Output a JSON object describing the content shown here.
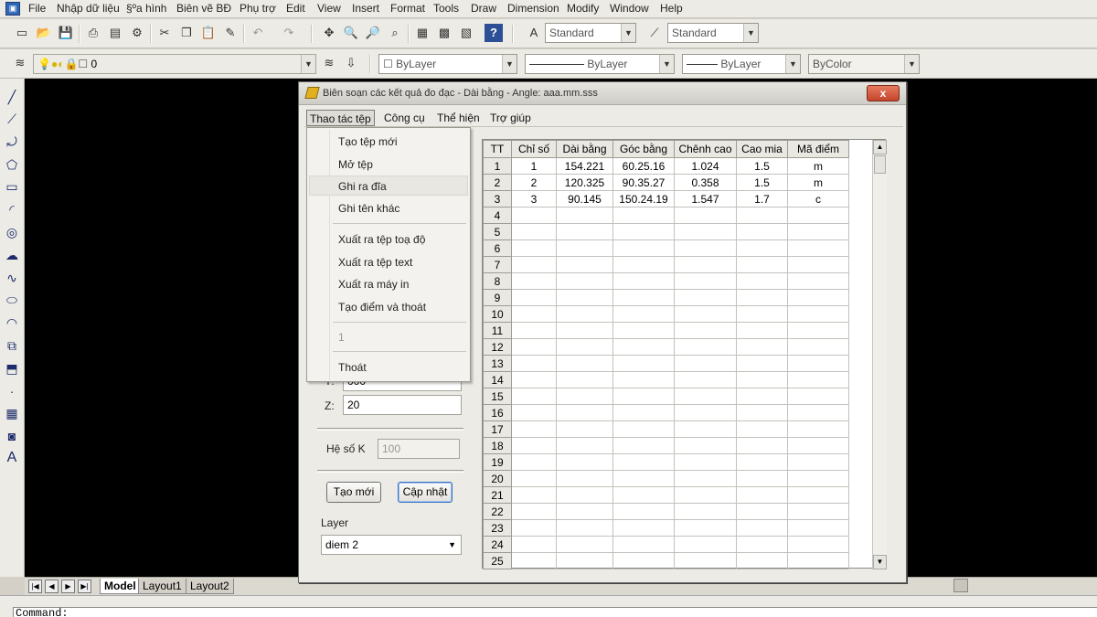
{
  "app": {
    "menu": [
      "File",
      "Nhập dữ liệu",
      "§ºa hình",
      "Biên vẽ BĐ",
      "Phụ trợ",
      "Edit",
      "View",
      "Insert",
      "Format",
      "Tools",
      "Draw",
      "Dimension",
      "Modify",
      "Window",
      "Help"
    ]
  },
  "toolbar": {
    "text_style": "Standard",
    "dim_style": "Standard",
    "layer_value": "0",
    "color": "ByLayer",
    "linetype": "ByLayer",
    "lineweight": "ByLayer",
    "plotstyle": "ByColor"
  },
  "layout_tabs": [
    "Model",
    "Layout1",
    "Layout2"
  ],
  "command": {
    "prompt": "Command:"
  },
  "dialog": {
    "title": "Biên soạn các kết quả đo đạc - Dài bằng - Angle: aaa.mm.sss",
    "close": "x",
    "menu": [
      "Thao tác tệp",
      "Công cụ",
      "Thể hiện",
      "Trợ giúp"
    ],
    "file_menu": {
      "items": [
        "Tạo tệp mới",
        "Mở tệp",
        "Ghi ra đĩa",
        "Ghi tên khác",
        "Xuất ra tệp toạ độ",
        "Xuất ra tệp text",
        "Xuất ra máy in",
        "Tạo điểm và thoát",
        "1",
        "Thoát"
      ],
      "highlighted": "Ghi ra đĩa"
    },
    "form": {
      "y_label": "Y:",
      "y_value": "000",
      "z_label": "Z:",
      "z_value": "20",
      "k_label": "Hệ số K",
      "k_value": "100",
      "btn_new": "Tạo mới",
      "btn_update": "Cập nhật",
      "layer_label": "Layer",
      "layer_value": "diem 2"
    },
    "grid": {
      "headers": [
        "TT",
        "Chỉ số",
        "Dài bằng",
        "Góc bằng",
        "Chênh cao",
        "Cao mia",
        "Mã điểm"
      ],
      "rows": [
        [
          "1",
          "1",
          "154.221",
          "60.25.16",
          "1.024",
          "1.5",
          "m"
        ],
        [
          "2",
          "2",
          "120.325",
          "90.35.27",
          "0.358",
          "1.5",
          "m"
        ],
        [
          "3",
          "3",
          "90.145",
          "150.24.19",
          "1.547",
          "1.7",
          "c"
        ],
        [
          "4",
          "",
          "",
          "",
          "",
          "",
          ""
        ],
        [
          "5",
          "",
          "",
          "",
          "",
          "",
          ""
        ],
        [
          "6",
          "",
          "",
          "",
          "",
          "",
          ""
        ],
        [
          "7",
          "",
          "",
          "",
          "",
          "",
          ""
        ],
        [
          "8",
          "",
          "",
          "",
          "",
          "",
          ""
        ],
        [
          "9",
          "",
          "",
          "",
          "",
          "",
          ""
        ],
        [
          "10",
          "",
          "",
          "",
          "",
          "",
          ""
        ],
        [
          "11",
          "",
          "",
          "",
          "",
          "",
          ""
        ],
        [
          "12",
          "",
          "",
          "",
          "",
          "",
          ""
        ],
        [
          "13",
          "",
          "",
          "",
          "",
          "",
          ""
        ],
        [
          "14",
          "",
          "",
          "",
          "",
          "",
          ""
        ],
        [
          "15",
          "",
          "",
          "",
          "",
          "",
          ""
        ],
        [
          "16",
          "",
          "",
          "",
          "",
          "",
          ""
        ],
        [
          "17",
          "",
          "",
          "",
          "",
          "",
          ""
        ],
        [
          "18",
          "",
          "",
          "",
          "",
          "",
          ""
        ],
        [
          "19",
          "",
          "",
          "",
          "",
          "",
          ""
        ],
        [
          "20",
          "",
          "",
          "",
          "",
          "",
          ""
        ],
        [
          "21",
          "",
          "",
          "",
          "",
          "",
          ""
        ],
        [
          "22",
          "",
          "",
          "",
          "",
          "",
          ""
        ],
        [
          "23",
          "",
          "",
          "",
          "",
          "",
          ""
        ],
        [
          "24",
          "",
          "",
          "",
          "",
          "",
          ""
        ],
        [
          "25",
          "",
          "",
          "",
          "",
          "",
          ""
        ]
      ]
    }
  }
}
